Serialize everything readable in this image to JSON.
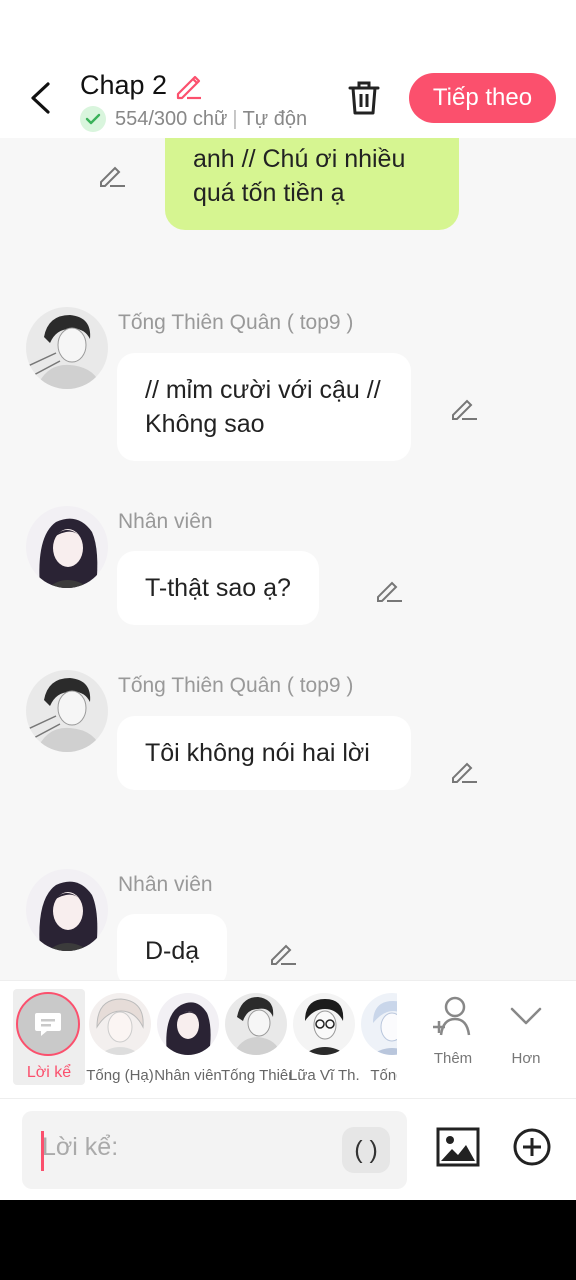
{
  "header": {
    "title": "Chap 2",
    "word_count": "554/300 chữ",
    "autosave": "Tự độn",
    "next_label": "Tiếp theo"
  },
  "messages": [
    {
      "type": "self",
      "text": "anh // Chú ơi nhiều quá tốn tiền ạ"
    },
    {
      "type": "other",
      "speaker": "Tống Thiên Quân ( top9 )",
      "avatar": "male-avatar-icon",
      "text": "// mỉm cười với cậu // Không sao"
    },
    {
      "type": "other",
      "speaker": "Nhân viên",
      "avatar": "female-avatar-icon",
      "text": "T-thật sao ạ?"
    },
    {
      "type": "other",
      "speaker": "Tống Thiên Quân ( top9 )",
      "avatar": "male-avatar-icon",
      "text": "Tôi không nói hai lời"
    },
    {
      "type": "other",
      "speaker": "Nhân viên",
      "avatar": "female-avatar-icon",
      "text": "D-dạ"
    }
  ],
  "charbar": {
    "narrator_label": "Lời kể",
    "characters": [
      {
        "label": "Tống (Hạ)",
        "avatar": "white-hair-avatar-icon"
      },
      {
        "label": "Nhân viên",
        "avatar": "female-avatar-icon"
      },
      {
        "label": "Tống Thiên...",
        "avatar": "male-avatar-icon"
      },
      {
        "label": "Lữa Vĩ Th...",
        "avatar": "glasses-avatar-icon"
      },
      {
        "label": "Tống (",
        "avatar": "blue-avatar-icon"
      }
    ],
    "add_label": "Thêm",
    "more_label": "Hơn"
  },
  "input": {
    "placeholder": "Lời kể:",
    "paren_label": "( )"
  },
  "colors": {
    "accent": "#fb506d",
    "self_bubble": "#d6f591",
    "background": "#f7f7f7"
  }
}
